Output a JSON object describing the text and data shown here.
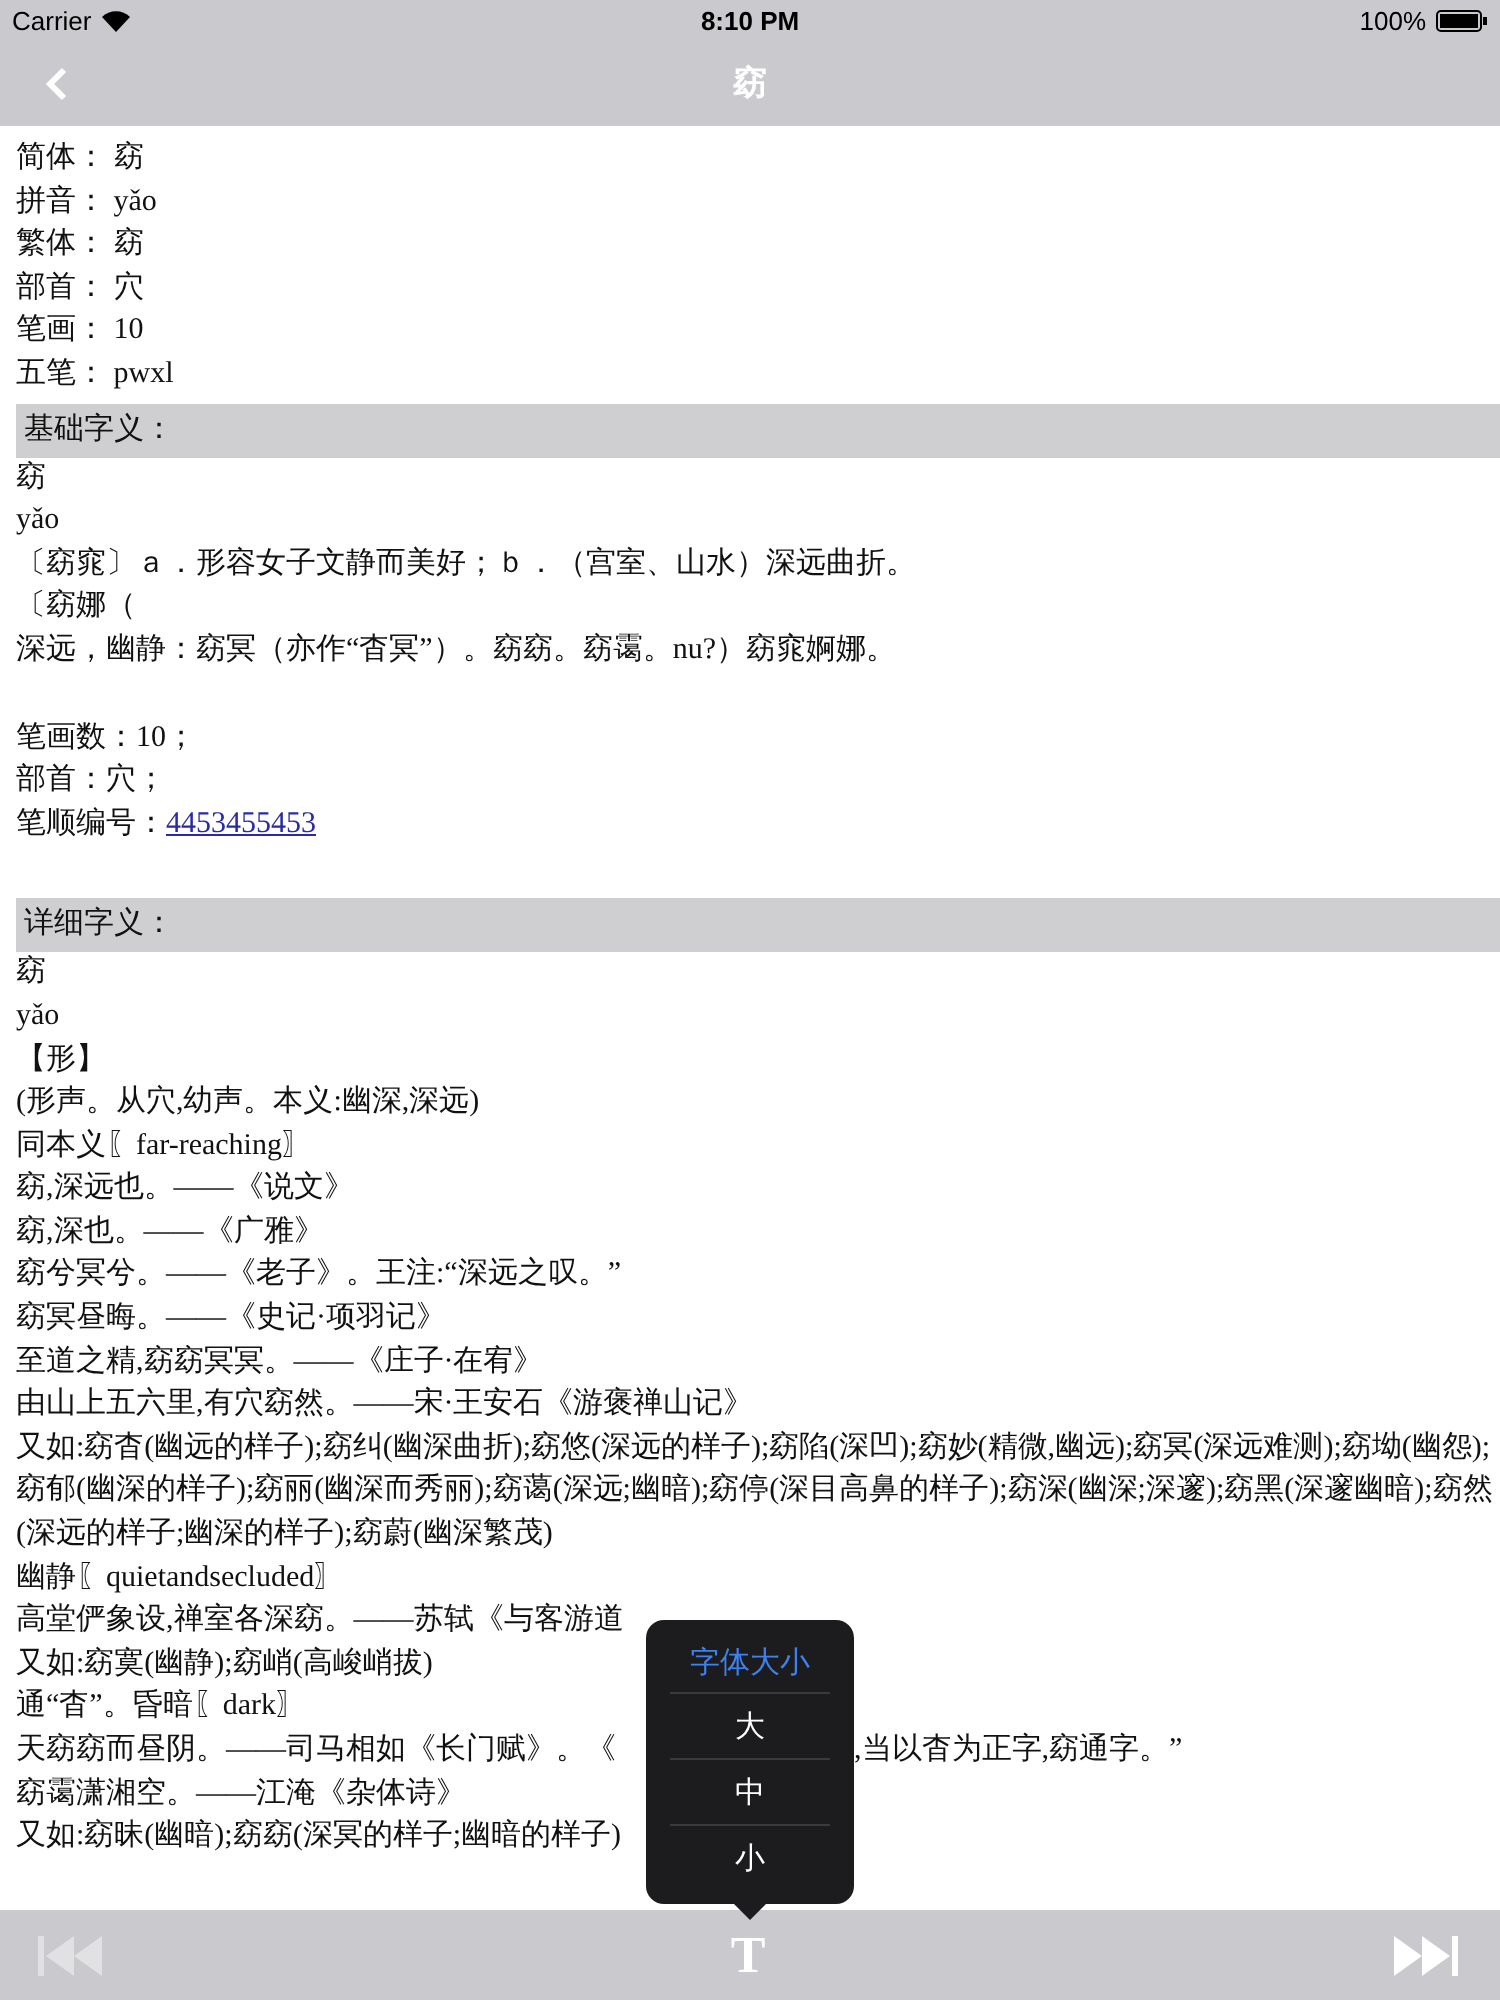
{
  "status_bar": {
    "carrier": "Carrier",
    "time": "8:10 PM",
    "battery": "100%"
  },
  "nav": {
    "title": "窈"
  },
  "info": [
    "简体：  窈",
    "拼音：  yǎo",
    "繁体：  窈",
    "部首：  穴",
    "笔画：  10",
    "五笔：  pwxl"
  ],
  "basic": {
    "heading": "基础字义：",
    "lines": [
      "窈",
      "yǎo",
      "〔窈窕〕ａ．形容女子文静而美好；ｂ．（宫室、山水）深远曲折。",
      "〔窈娜（",
      "深远，幽静：窈冥（亦作“杳冥”）。窈窈。窈霭。nu?）窈窕婀娜。"
    ],
    "stats": [
      {
        "kind": "text",
        "label": "笔画数：10；"
      },
      {
        "kind": "text",
        "label": "部首：穴；"
      },
      {
        "kind": "link",
        "label": "笔顺编号：",
        "link": "4453455453"
      }
    ]
  },
  "detail": {
    "heading": "详细字义：",
    "lines": [
      {
        "text": "窈"
      },
      {
        "text": "yǎo"
      },
      {
        "text": "【形】"
      },
      {
        "text": "(形声。从穴,幼声。本义:幽深,深远)"
      },
      {
        "text": "同本义〖far-reaching〗"
      },
      {
        "text": "窈,深远也。——《说文》"
      },
      {
        "text": "窈,深也。——《广雅》"
      },
      {
        "text": "窈兮冥兮。——《老子》。王注:“深远之叹。”"
      },
      {
        "text": "窈冥昼晦。——《史记·项羽记》"
      },
      {
        "text": "至道之精,窈窈冥冥。——《庄子·在宥》"
      },
      {
        "text": "由山上五六里,有穴窈然。——宋·王安石《游褒禅山记》"
      },
      {
        "text": "又如:窈杳(幽远的样子);窈纠(幽深曲折);窈悠(深远的样子);窈陷(深凹);窈妙(精微,幽远);窈冥(深远难测);窈坳(幽怨);窈郁(幽深的样子);窈丽(幽深而秀丽);窈蔼(深远;幽暗);窈停(深目高鼻的样子);窈深(幽深;深邃);窈黑(深邃幽暗);窈然(深远的样子;幽深的样子);窈蔚(幽深繁茂)"
      },
      {
        "text": "幽静〖quietandsecluded〗"
      },
      {
        "text": "高堂俨象设,禅室各深窈。——苏轼《与客游道"
      },
      {
        "text": "又如:窈寞(幽静);窈峭(高峻峭拔)"
      },
      {
        "text": "通“杳”。昏暗〖dark〗"
      },
      {
        "text": "天窈窈而昼阴。——司马相如《长门赋》。《",
        "after": ",当以杳为正字,窈通字。”"
      },
      {
        "text": "窈霭潇湘空。——江淹《杂体诗》"
      },
      {
        "text": "又如:窈昧(幽暗);窈窈(深冥的样子;幽暗的样子)"
      }
    ]
  },
  "font_menu": {
    "title": "字体大小",
    "options": [
      "大",
      "中",
      "小"
    ]
  },
  "toolbar": {
    "first_disabled": true,
    "font_button": "T",
    "last_disabled": false
  }
}
